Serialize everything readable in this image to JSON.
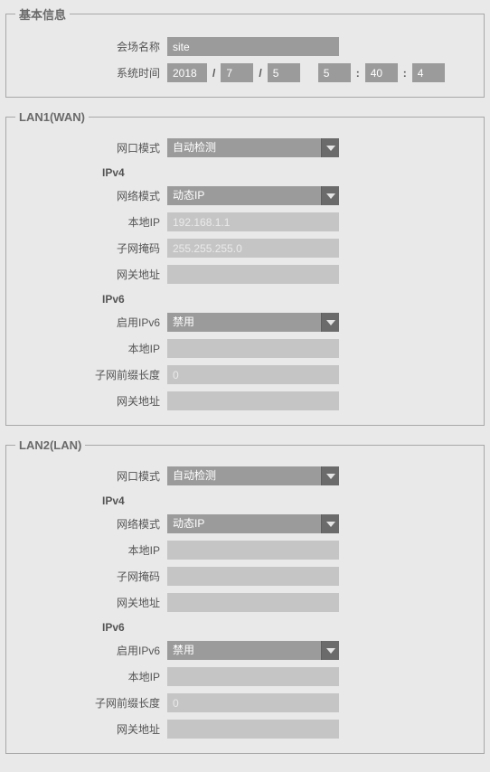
{
  "basic": {
    "legend": "基本信息",
    "siteLabel": "会场名称",
    "siteValue": "site",
    "timeLabel": "系统时间",
    "year": "2018",
    "month": "7",
    "day": "5",
    "hour": "5",
    "minute": "40",
    "second": "4",
    "slash": "/",
    "colon": ":"
  },
  "lan1": {
    "legend": "LAN1(WAN)",
    "portModeLabel": "网口模式",
    "portModeValue": "自动检测",
    "ipv4Header": "IPv4",
    "netModeLabel": "网络模式",
    "netModeValue": "动态IP",
    "localIpLabel": "本地IP",
    "localIpValue": "192.168.1.1",
    "maskLabel": "子网掩码",
    "maskValue": "255.255.255.0",
    "gwLabel": "网关地址",
    "gwValue": "",
    "ipv6Header": "IPv6",
    "ipv6EnableLabel": "启用IPv6",
    "ipv6EnableValue": "禁用",
    "ipv6LocalIpLabel": "本地IP",
    "ipv6LocalIpValue": "",
    "ipv6PrefixLabel": "子网前缀长度",
    "ipv6PrefixValue": "0",
    "ipv6GwLabel": "网关地址",
    "ipv6GwValue": ""
  },
  "lan2": {
    "legend": "LAN2(LAN)",
    "portModeLabel": "网口模式",
    "portModeValue": "自动检测",
    "ipv4Header": "IPv4",
    "netModeLabel": "网络模式",
    "netModeValue": "动态IP",
    "localIpLabel": "本地IP",
    "localIpValue": "",
    "maskLabel": "子网掩码",
    "maskValue": "",
    "gwLabel": "网关地址",
    "gwValue": "",
    "ipv6Header": "IPv6",
    "ipv6EnableLabel": "启用IPv6",
    "ipv6EnableValue": "禁用",
    "ipv6LocalIpLabel": "本地IP",
    "ipv6LocalIpValue": "",
    "ipv6PrefixLabel": "子网前缀长度",
    "ipv6PrefixValue": "0",
    "ipv6GwLabel": "网关地址",
    "ipv6GwValue": ""
  }
}
